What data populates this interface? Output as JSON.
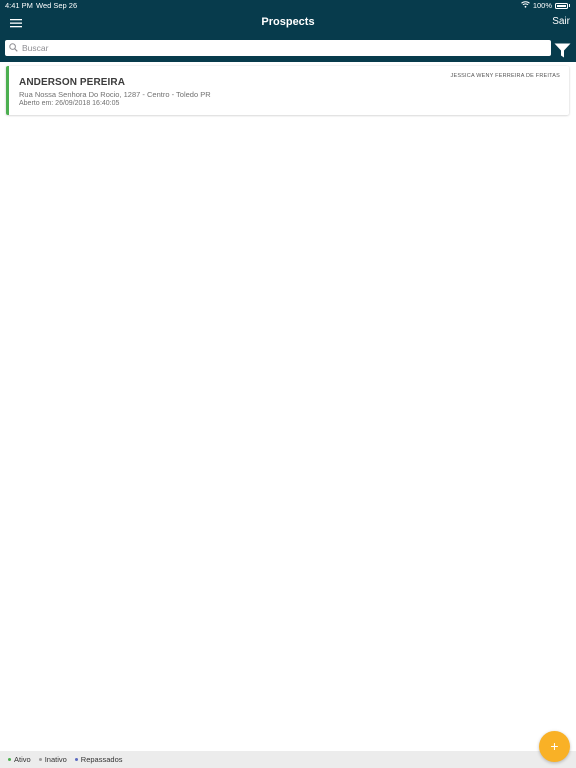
{
  "status_bar": {
    "time": "4:41 PM",
    "date": "Wed Sep 26",
    "battery": "100%",
    "wifi_icon": "wifi-icon",
    "battery_icon": "battery-icon"
  },
  "header": {
    "title": "Prospects",
    "logout_label": "Sair",
    "menu_icon": "hamburger-menu-icon",
    "background": "#073b4c"
  },
  "search": {
    "placeholder": "Buscar",
    "value": "",
    "icon": "search-icon",
    "filter_icon": "filter-funnel-icon"
  },
  "prospects": [
    {
      "name": "ANDERSON PEREIRA",
      "assignee": "JESSICA WENY FERREIRA DE FREITAS",
      "address": "Rua Nossa Senhora Do Rocio, 1287 - Centro - Toledo PR",
      "opened": "Aberto em: 26/09/2018 16:40:05",
      "status": "Ativo",
      "status_color": "#4caf50"
    }
  ],
  "legend": [
    {
      "label": "Ativo",
      "color": "#4caf50"
    },
    {
      "label": "Inativo",
      "color": "#9e9e9e"
    },
    {
      "label": "Repassados",
      "color": "#5c6bc0"
    }
  ],
  "fab": {
    "label": "+",
    "color": "#f9b126",
    "icon": "plus-icon"
  }
}
